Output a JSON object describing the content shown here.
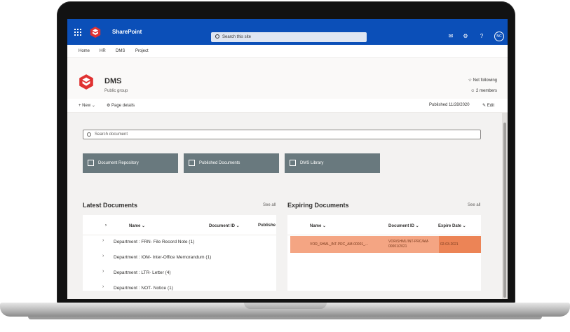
{
  "topbar": {
    "app_name": "SharePoint",
    "search_placeholder": "Search this site",
    "user_initials": "NC",
    "accent": "#0b4fb8"
  },
  "nav": {
    "items": [
      "Home",
      "HR",
      "DMS",
      "Project"
    ]
  },
  "site": {
    "title": "DMS",
    "subtitle": "Public group",
    "follow": "Not following",
    "members": "2 members"
  },
  "commands": {
    "new": "New",
    "page_details": "Page details",
    "published": "Published 11/28/2020",
    "edit": "Edit"
  },
  "content": {
    "search_placeholder": "Search document",
    "tiles": [
      "Document Repository",
      "Published Documents",
      "DMS Library"
    ],
    "tile_color": "#69797e"
  },
  "latest": {
    "title": "Latest Documents",
    "see_all": "See all",
    "columns": [
      "Name",
      "Document ID",
      "Publishe"
    ],
    "groups": [
      "Department : FRN- File Record Note (1)",
      "Department : IOM- Inter-Office Memorandum (1)",
      "Department : LTR- Letter (4)",
      "Department : NOT- Notice (1)"
    ]
  },
  "expiring": {
    "title": "Expiring Documents",
    "see_all": "See all",
    "columns": [
      "Name",
      "Document ID",
      "Expire Date"
    ],
    "rows": [
      {
        "name": "VOR_SHML_INT-PRC_AM-00001_...",
        "doc_id": "VOR/SHML/INT-PRC/AM-00001/2021",
        "expire_date": "02-03-2021"
      }
    ],
    "row_color": "#f4a583",
    "date_color": "#ec8456"
  }
}
